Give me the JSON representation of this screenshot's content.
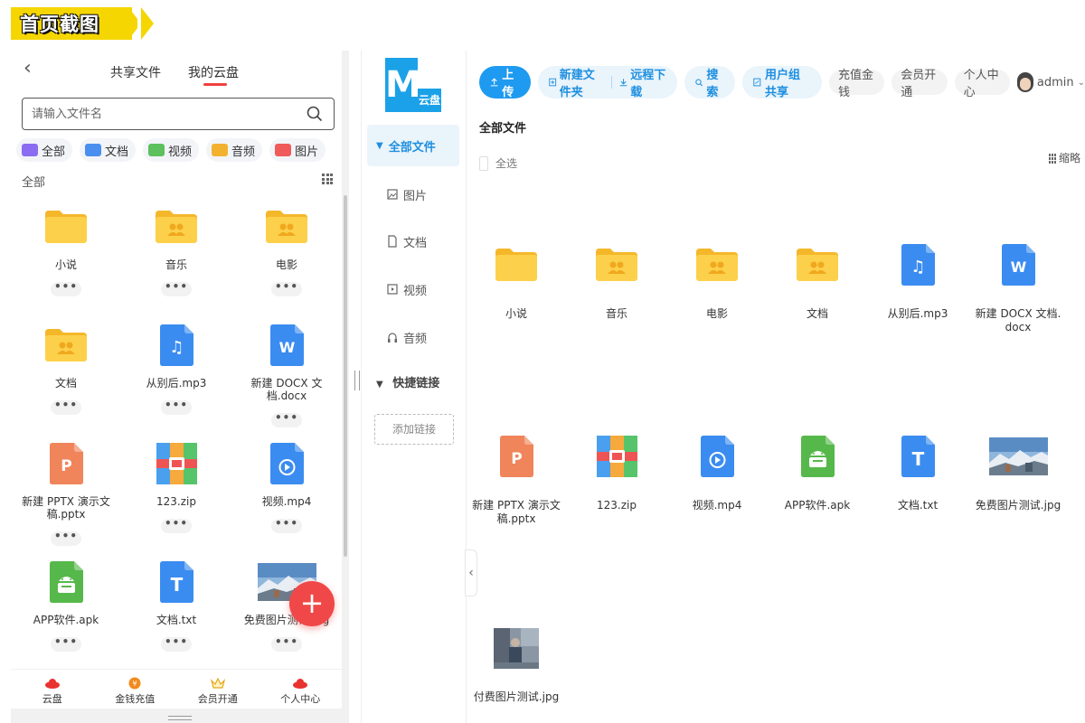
{
  "banner": {
    "text": "首页截图"
  },
  "colors": {
    "accent": "#1e9af0",
    "fab": "#f04848",
    "folder": "#f9c93c",
    "banner": "#f5d600"
  },
  "mobile": {
    "tabs": {
      "shared": "共享文件",
      "mine": "我的云盘"
    },
    "search": {
      "placeholder": "请输入文件名"
    },
    "categories": [
      {
        "label": "全部",
        "icon": "all-icon"
      },
      {
        "label": "文档",
        "icon": "document-icon"
      },
      {
        "label": "视频",
        "icon": "video-icon"
      },
      {
        "label": "音频",
        "icon": "audio-icon"
      },
      {
        "label": "图片",
        "icon": "image-icon"
      }
    ],
    "section_label": "全部",
    "files": [
      {
        "name": "小说",
        "type": "folder"
      },
      {
        "name": "音乐",
        "type": "folder-shared"
      },
      {
        "name": "电影",
        "type": "folder-shared"
      },
      {
        "name": "文档",
        "type": "folder-shared"
      },
      {
        "name": "从别后.mp3",
        "type": "mp3"
      },
      {
        "name": "新建 DOCX 文档.docx",
        "type": "docx"
      },
      {
        "name": "新建 PPTX 演示文稿.pptx",
        "type": "pptx"
      },
      {
        "name": "123.zip",
        "type": "zip"
      },
      {
        "name": "视频.mp4",
        "type": "mp4"
      },
      {
        "name": "APP软件.apk",
        "type": "apk"
      },
      {
        "name": "文档.txt",
        "type": "txt"
      },
      {
        "name": "免费图片测试.jpg",
        "type": "jpg"
      }
    ],
    "more_label": "•••",
    "fab_label": "+",
    "bottom_nav": [
      {
        "label": "云盘",
        "icon": "cloud-icon"
      },
      {
        "label": "金钱充值",
        "icon": "coin-icon"
      },
      {
        "label": "会员开通",
        "icon": "crown-icon"
      },
      {
        "label": "个人中心",
        "icon": "user-icon"
      }
    ]
  },
  "desktop": {
    "logo": {
      "letter": "M",
      "sub": "云盘"
    },
    "sidebar": {
      "items": [
        {
          "label": "全部文件",
          "icon": "caret-down-icon"
        },
        {
          "label": "图片",
          "icon": "image-icon"
        },
        {
          "label": "文档",
          "icon": "document-icon"
        },
        {
          "label": "视频",
          "icon": "video-icon"
        },
        {
          "label": "音频",
          "icon": "headphones-icon"
        }
      ],
      "group_label": "快捷链接",
      "add_link": "添加链接",
      "collapse": "‹"
    },
    "toolbar": {
      "upload": "上传",
      "new_folder": "新建文件夹",
      "remote_download": "远程下载",
      "search": "搜索",
      "group_share": "用户组共享",
      "recharge": "充值金钱",
      "membership": "会员开通",
      "profile": "个人中心",
      "user": "admin"
    },
    "breadcrumb": "全部文件",
    "select_all": "全选",
    "thumbnail_toggle": "缩略",
    "files": [
      {
        "name": "小说",
        "type": "folder"
      },
      {
        "name": "音乐",
        "type": "folder-shared"
      },
      {
        "name": "电影",
        "type": "folder-shared"
      },
      {
        "name": "文档",
        "type": "folder-shared"
      },
      {
        "name": "从别后.mp3",
        "type": "mp3"
      },
      {
        "name": "新建 DOCX 文档.docx",
        "type": "docx"
      },
      {
        "name": "新建 PPTX 演示文稿.pptx",
        "type": "pptx"
      },
      {
        "name": "123.zip",
        "type": "zip"
      },
      {
        "name": "视频.mp4",
        "type": "mp4"
      },
      {
        "name": "APP软件.apk",
        "type": "apk"
      },
      {
        "name": "文档.txt",
        "type": "txt"
      },
      {
        "name": "免费图片测试.jpg",
        "type": "jpg"
      },
      {
        "name": "付费图片测试.jpg",
        "type": "jpg-dark"
      }
    ]
  }
}
